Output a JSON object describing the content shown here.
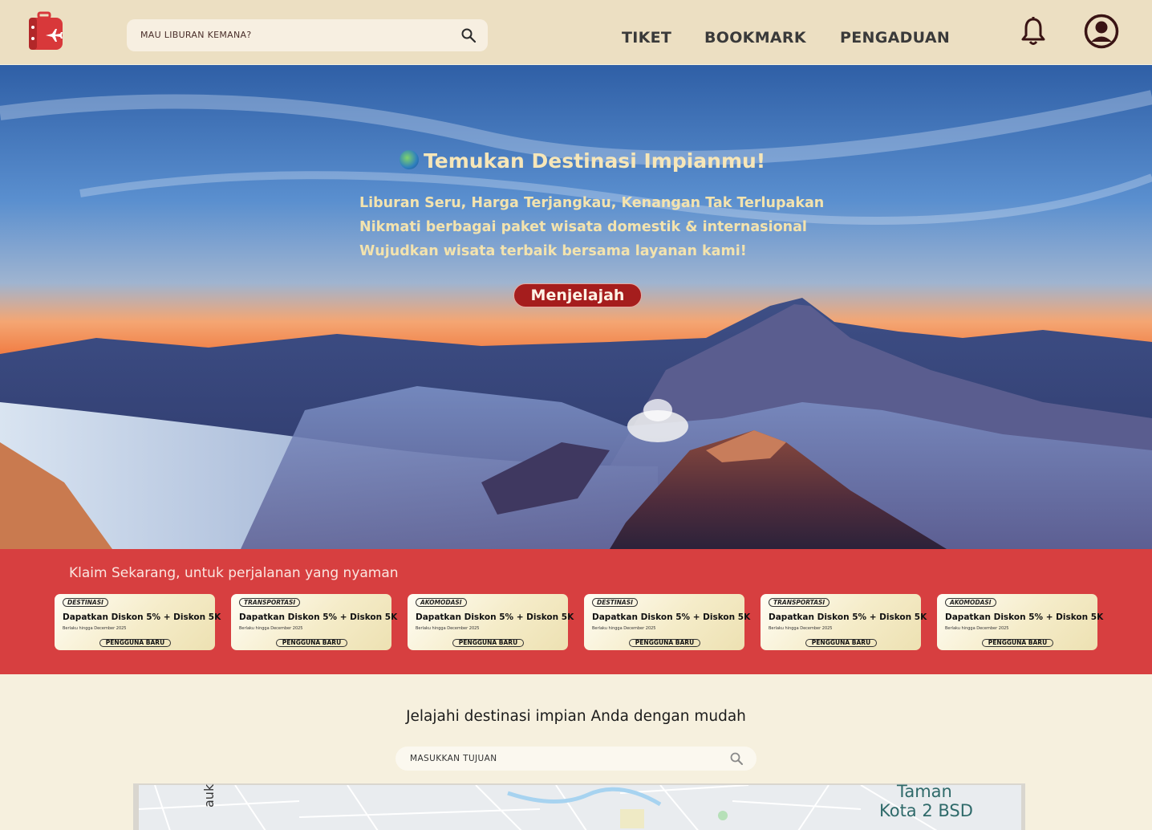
{
  "header": {
    "search_placeholder": "MAU LIBURAN KEMANA?",
    "nav": [
      "TIKET",
      "BOOKMARK",
      "PENGADUAN"
    ]
  },
  "hero": {
    "title": "Temukan Destinasi Impianmu!",
    "lines": [
      "Liburan Seru, Harga Terjangkau, Kenangan Tak Terlupakan",
      "Nikmati berbagai paket wisata domestik & internasional",
      "Wujudkan wisata terbaik bersama layanan kami!"
    ],
    "button": "Menjelajah"
  },
  "promo": {
    "title": "Klaim Sekarang, untuk perjalanan yang nyaman",
    "cards": [
      {
        "tag": "DESTINASI",
        "title": "Dapatkan Diskon 5% + Diskon 5K",
        "sub": "Berlaku hingga December 2025",
        "badge": "PENGGUNA BARU"
      },
      {
        "tag": "TRANSPORTASI",
        "title": "Dapatkan Diskon 5% + Diskon 5K",
        "sub": "Berlaku hingga December 2025",
        "badge": "PENGGUNA BARU"
      },
      {
        "tag": "AKOMODASI",
        "title": "Dapatkan Diskon 5% + Diskon 5K",
        "sub": "Berlaku hingga December 2025",
        "badge": "PENGGUNA BARU"
      },
      {
        "tag": "DESTINASI",
        "title": "Dapatkan Diskon 5% + Diskon 5K",
        "sub": "Berlaku hingga December 2025",
        "badge": "PENGGUNA BARU"
      },
      {
        "tag": "TRANSPORTASI",
        "title": "Dapatkan Diskon 5% + Diskon 5K",
        "sub": "Berlaku hingga December 2025",
        "badge": "PENGGUNA BARU"
      },
      {
        "tag": "AKOMODASI",
        "title": "Dapatkan Diskon 5% + Diskon 5K",
        "sub": "Berlaku hingga December 2025",
        "badge": "PENGGUNA BARU"
      }
    ]
  },
  "explore": {
    "heading": "Jelajahi destinasi impian Anda dengan mudah",
    "search_placeholder": "MASUKKAN TUJUAN"
  },
  "map": {
    "labels": [
      "Taman",
      "Kota 2 BSD"
    ],
    "partial_street": "auk"
  },
  "colors": {
    "header_bg": "#ecdfc2",
    "promo_bg": "#d73f40",
    "button_bg": "#a51d1d",
    "page_bg": "#f6f0de"
  },
  "icons": [
    "suitcase-plane-logo",
    "search-icon",
    "bell-icon",
    "user-icon",
    "globe-icon"
  ]
}
